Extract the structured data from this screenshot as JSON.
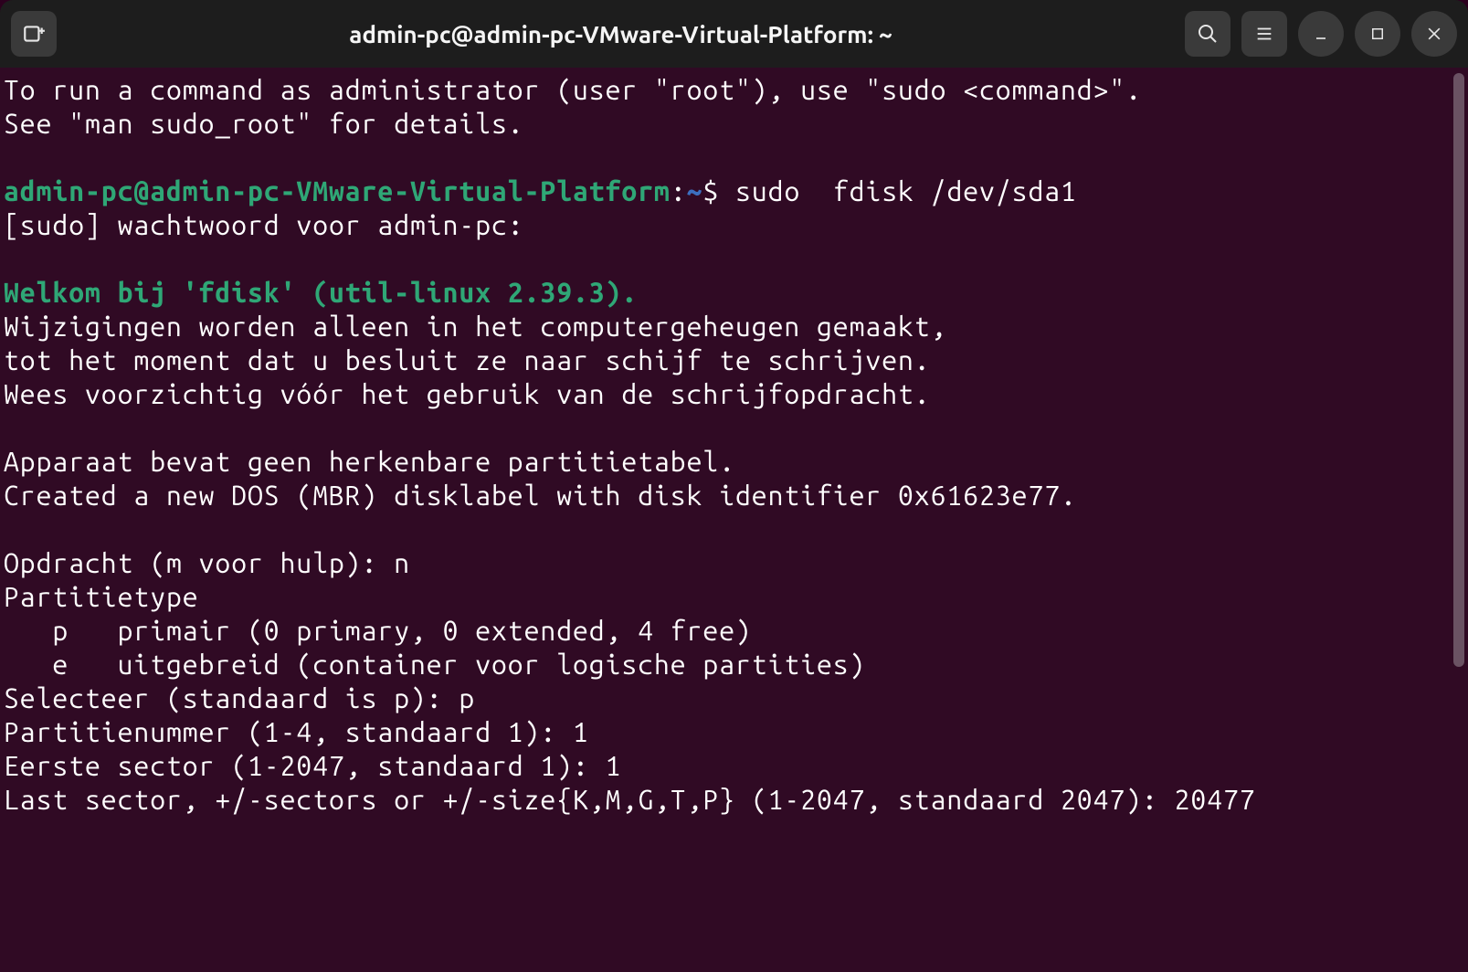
{
  "header": {
    "title": "admin-pc@admin-pc-VMware-Virtual-Platform: ~"
  },
  "terminal": {
    "intro1": "To run a command as administrator (user \"root\"), use \"sudo <command>\".",
    "intro2": "See \"man sudo_root\" for details.",
    "prompt_user": "admin-pc@admin-pc-VMware-Virtual-Platform",
    "prompt_sep": ":",
    "prompt_path": "~",
    "prompt_dollar": "$ ",
    "command": "sudo  fdisk /dev/sda1",
    "sudo_prompt": "[sudo] wachtwoord voor admin-pc: ",
    "welcome": "Welkom bij 'fdisk' (util-linux 2.39.3).",
    "mem1": "Wijzigingen worden alleen in het computergeheugen gemaakt,",
    "mem2": "tot het moment dat u besluit ze naar schijf te schrijven.",
    "mem3": "Wees voorzichtig vóór het gebruik van de schrijfopdracht.",
    "nopart": "Apparaat bevat geen herkenbare partitietabel.",
    "newlabel": "Created a new DOS (MBR) disklabel with disk identifier 0x61623e77.",
    "cmd_prompt": "Opdracht (m voor hulp): ",
    "cmd_input": "n",
    "ptype_header": "Partitietype",
    "ptype_p": "   p   primair (0 primary, 0 extended, 4 free)",
    "ptype_e": "   e   uitgebreid (container voor logische partities)",
    "select_prompt": "Selecteer (standaard is p): ",
    "select_input": "p",
    "partnum_prompt": "Partitienummer (1-4, standaard 1): ",
    "partnum_input": "1",
    "first_prompt": "Eerste sector (1-2047, standaard 1): ",
    "first_input": "1",
    "last_prompt": "Last sector, +/-sectors or +/-size{K,M,G,T,P} (1-2047, standaard 2047): ",
    "last_input": "20477"
  }
}
